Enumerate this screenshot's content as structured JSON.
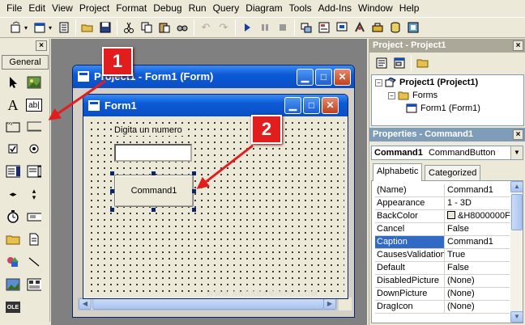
{
  "menu": [
    "File",
    "Edit",
    "View",
    "Project",
    "Format",
    "Debug",
    "Run",
    "Query",
    "Diagram",
    "Tools",
    "Add-Ins",
    "Window",
    "Help"
  ],
  "toolbar": {
    "icons": [
      "add-project-icon",
      "add-form-icon",
      "menu-editor-icon",
      "open-icon",
      "save-icon",
      "cut-icon",
      "copy-icon",
      "paste-icon",
      "find-icon",
      "undo-icon",
      "redo-icon",
      "start-icon",
      "break-icon",
      "end-icon",
      "project-explorer-icon",
      "properties-window-icon",
      "form-layout-icon",
      "object-browser-icon",
      "toolbox-icon",
      "data-view-icon",
      "component-manager-icon"
    ]
  },
  "toolbox": {
    "tab_label": "General",
    "label_glyph": "A",
    "textbox_glyph": "ab|",
    "ole_label": "OLE"
  },
  "project_window": {
    "title": "Project1 - Form1 (Form)"
  },
  "form_window": {
    "title": "Form1",
    "label_text": "Digita un numero",
    "button_caption": "Command1"
  },
  "watermark": "WWW.ANDREAMININI.COM",
  "callouts": [
    "1",
    "2"
  ],
  "project_panel": {
    "title": "Project - Project1",
    "tree": [
      {
        "label": "Project1 (Project1)",
        "toggle": "−"
      },
      {
        "label": "Forms",
        "toggle": "−"
      },
      {
        "label": "Form1 (Form1)"
      }
    ]
  },
  "properties_panel": {
    "title": "Properties - Command1",
    "object_name": "Command1",
    "object_type": "CommandButton",
    "tabs": [
      "Alphabetic",
      "Categorized"
    ],
    "rows": [
      {
        "name": "(Name)",
        "value": "Command1"
      },
      {
        "name": "Appearance",
        "value": "1 - 3D"
      },
      {
        "name": "BackColor",
        "value": "&H8000000F"
      },
      {
        "name": "Cancel",
        "value": "False"
      },
      {
        "name": "Caption",
        "value": "Command1"
      },
      {
        "name": "CausesValidation",
        "value": "True"
      },
      {
        "name": "Default",
        "value": "False"
      },
      {
        "name": "DisabledPicture",
        "value": "(None)"
      },
      {
        "name": "DownPicture",
        "value": "(None)"
      },
      {
        "name": "DragIcon",
        "value": "(None)"
      }
    ]
  },
  "colors": {
    "callout_red": "#e21d1d",
    "title_blue": "#0c5ad6",
    "selection_blue": "#316ac5"
  }
}
